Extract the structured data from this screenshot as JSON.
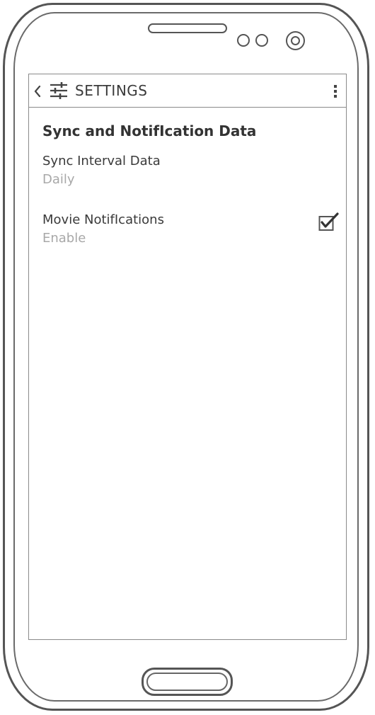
{
  "action_bar": {
    "title": "SETTINGS",
    "back_icon": "chevron-left-icon",
    "settings_icon": "sliders-icon",
    "overflow_icon": "vertical-dots-icon"
  },
  "section": {
    "title": "Sync and NotifIcation Data"
  },
  "preferences": [
    {
      "title": "Sync Interval Data",
      "summary": "Daily"
    },
    {
      "title": "Movie NotifIcations",
      "summary": "Enable",
      "checked": true
    }
  ],
  "colors": {
    "stroke": "#555555",
    "text": "#3a3a3a",
    "summary_text": "#a8a8a8",
    "screen_border": "#8a8a8a"
  }
}
